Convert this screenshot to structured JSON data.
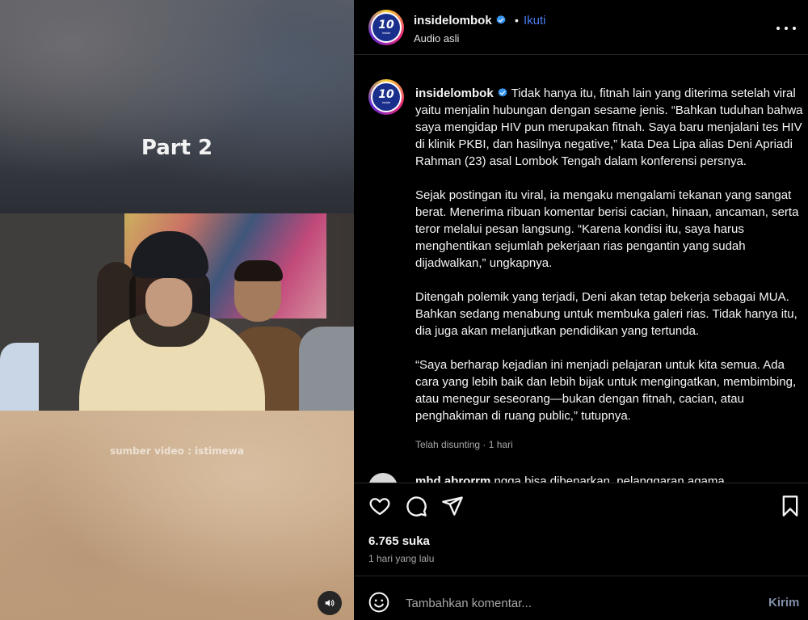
{
  "media": {
    "overlay_title": "Part 2",
    "source_caption": "sumber video : istimewa"
  },
  "header": {
    "username": "insidelombok",
    "separator": "•",
    "follow_label": "Ikuti",
    "audio_label": "Audio asli",
    "avatar_text": "10",
    "avatar_subtext": "Inside"
  },
  "caption": {
    "username": "insidelombok",
    "paragraphs": [
      "Tidak hanya itu, fitnah lain yang diterima setelah viral yaitu menjalin hubungan dengan sesame jenis. “Bahkan tuduhan bahwa saya mengidap HIV pun merupakan fitnah. Saya baru menjalani tes HIV di klinik PKBI, dan hasilnya negative,” kata Dea Lipa alias Deni Apriadi Rahman (23) asal Lombok Tengah dalam konferensi persnya.",
      "Sejak postingan itu viral, ia mengaku mengalami tekanan yang sangat berat. Menerima ribuan komentar berisi cacian, hinaan, ancaman, serta teror melalui pesan langsung. “Karena kondisi itu, saya harus menghentikan sejumlah pekerjaan rias pengantin yang sudah dijadwalkan,” ungkapnya.",
      "Ditengah polemik yang terjadi, Deni akan tetap bekerja sebagai MUA. Bahkan sedang menabung untuk membuka galeri rias. Tidak hanya itu, dia juga akan melanjutkan pendidikan yang tertunda.",
      "“Saya berharap kejadian ini menjadi pelajaran untuk kita semua. Ada cara yang lebih baik dan lebih bijak untuk mengingatkan, membimbing, atau menegur seseorang—bukan dengan fitnah, cacian, atau penghakiman di ruang public,” tutupnya."
    ],
    "meta": "Telah disunting · 1 hari"
  },
  "next_comment": {
    "username": "mhd.abrorrm",
    "text": "ngga bisa dibenarkan, pelanggaran agama"
  },
  "footer": {
    "likes": "6.765 suka",
    "time_ago": "1 hari yang lalu",
    "comment_placeholder": "Tambahkan komentar...",
    "post_label": "Kirim"
  },
  "icons": {
    "like": "heart-icon",
    "comment": "comment-bubble-icon",
    "share": "paper-plane-icon",
    "save": "bookmark-icon",
    "emoji": "smiley-icon",
    "sound": "speaker-icon",
    "more": "more-dots-icon",
    "verified": "verified-badge-icon"
  },
  "colors": {
    "background": "#000000",
    "link_blue": "#4d7cf0",
    "muted_text": "#a8a8a8",
    "verified_blue": "#3897f0"
  }
}
